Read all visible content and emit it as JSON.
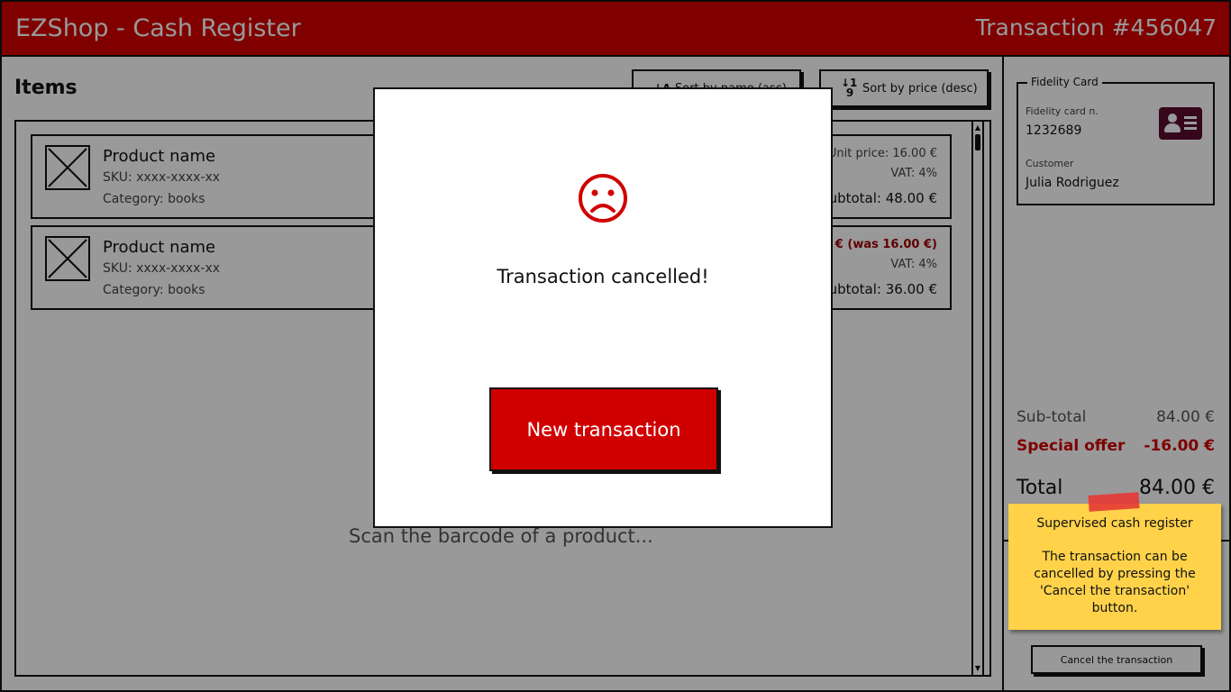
{
  "header": {
    "app_title": "EZShop - Cash Register",
    "transaction": "Transaction #456047"
  },
  "items_panel": {
    "title": "Items",
    "sort_name_label": "Sort by name (asc)",
    "sort_price_label": "Sort by price (desc)",
    "sort_name_icon": "A-Z",
    "sort_price_icon": "1-9",
    "scan_hint": "Scan the barcode of a product..."
  },
  "products": [
    {
      "name": "Product name",
      "sku": "SKU: xxxx-xxxx-xx",
      "category": "Category: books",
      "price_line": "Unit price: 16.00 €",
      "vat": "VAT: 4%",
      "subtotal": "Subtotal: 48.00 €"
    },
    {
      "name": "Product name",
      "sku": "SKU: xxxx-xxxx-xx",
      "category": "Category: books",
      "price_line": "12.00 € (was 16.00 €)",
      "vat": "VAT: 4%",
      "subtotal": "Subtotal: 36.00 €"
    }
  ],
  "fidelity": {
    "legend": "Fidelity Card",
    "card_label": "Fidelity card n.",
    "card_number": "1232689",
    "customer_label": "Customer",
    "customer_name": "Julia Rodriguez"
  },
  "totals": {
    "subtotal_label": "Sub-total",
    "subtotal_value": "84.00 €",
    "offer_label": "Special offer",
    "offer_value": "-16.00 €",
    "total_label": "Total",
    "total_value": "84.00 €"
  },
  "cancel_label": "Cancel the transaction",
  "modal": {
    "message": "Transaction cancelled!",
    "button_label": "New transaction"
  },
  "note": {
    "title": "Supervised cash register",
    "body": "The transaction can be cancelled by pressing the 'Cancel the transaction' button."
  },
  "colors": {
    "brand": "#d50000",
    "offer": "#d00000",
    "note": "#ffd24a"
  }
}
